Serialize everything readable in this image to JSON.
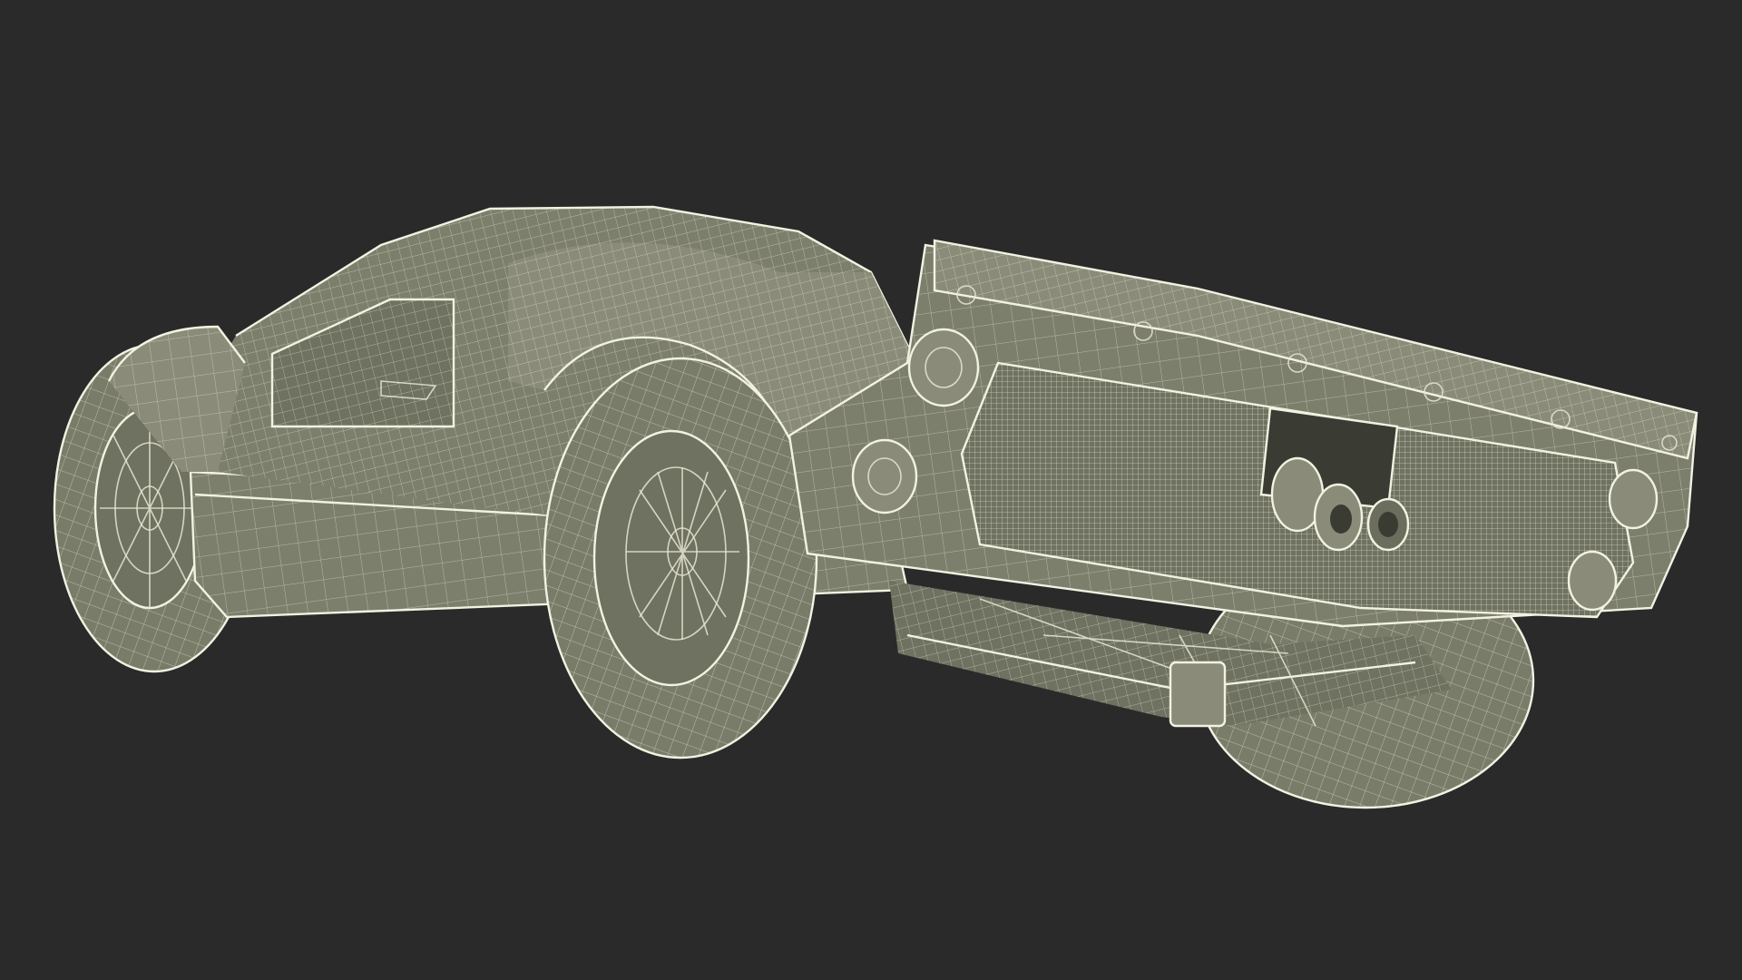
{
  "scene": {
    "subject": "car-wireframe",
    "colors": {
      "background": "#2a2a2a",
      "body": "#7d7f6d",
      "wire": "#e6e6d2"
    },
    "icons": [
      "car-body-icon",
      "rear-wheel-icon",
      "front-wheel-icon",
      "exhaust-icon",
      "spoiler-icon"
    ]
  }
}
